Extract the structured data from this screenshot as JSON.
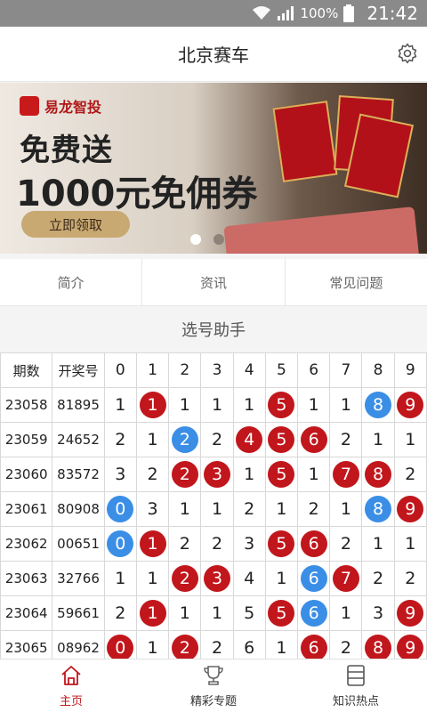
{
  "status": {
    "battery": "100%",
    "time": "21:42"
  },
  "header": {
    "title": "北京赛车"
  },
  "banner": {
    "brand": "易龙智投",
    "line1": "免费送",
    "line2": "1000元免佣券",
    "cta": "立即领取",
    "slides_active": 1,
    "slides_total": 2
  },
  "tabs": [
    {
      "label": "简介"
    },
    {
      "label": "资讯"
    },
    {
      "label": "常见问题"
    }
  ],
  "section_title": "选号助手",
  "table": {
    "headers": [
      "期数",
      "开奖号",
      "0",
      "1",
      "2",
      "3",
      "4",
      "5",
      "6",
      "7",
      "8",
      "9"
    ],
    "rows": [
      {
        "issue": "23058",
        "code": "81895",
        "cells": [
          {
            "v": "1",
            "s": ""
          },
          {
            "v": "1",
            "s": "red"
          },
          {
            "v": "1",
            "s": ""
          },
          {
            "v": "1",
            "s": ""
          },
          {
            "v": "1",
            "s": ""
          },
          {
            "v": "5",
            "s": "red"
          },
          {
            "v": "1",
            "s": ""
          },
          {
            "v": "1",
            "s": ""
          },
          {
            "v": "8",
            "s": "blue"
          },
          {
            "v": "9",
            "s": "red"
          }
        ]
      },
      {
        "issue": "23059",
        "code": "24652",
        "cells": [
          {
            "v": "2",
            "s": ""
          },
          {
            "v": "1",
            "s": ""
          },
          {
            "v": "2",
            "s": "blue"
          },
          {
            "v": "2",
            "s": ""
          },
          {
            "v": "4",
            "s": "red"
          },
          {
            "v": "5",
            "s": "red"
          },
          {
            "v": "6",
            "s": "red"
          },
          {
            "v": "2",
            "s": ""
          },
          {
            "v": "1",
            "s": ""
          },
          {
            "v": "1",
            "s": ""
          }
        ]
      },
      {
        "issue": "23060",
        "code": "83572",
        "cells": [
          {
            "v": "3",
            "s": ""
          },
          {
            "v": "2",
            "s": ""
          },
          {
            "v": "2",
            "s": "red"
          },
          {
            "v": "3",
            "s": "red"
          },
          {
            "v": "1",
            "s": ""
          },
          {
            "v": "5",
            "s": "red"
          },
          {
            "v": "1",
            "s": ""
          },
          {
            "v": "7",
            "s": "red"
          },
          {
            "v": "8",
            "s": "red"
          },
          {
            "v": "2",
            "s": ""
          }
        ]
      },
      {
        "issue": "23061",
        "code": "80908",
        "cells": [
          {
            "v": "0",
            "s": "blue"
          },
          {
            "v": "3",
            "s": ""
          },
          {
            "v": "1",
            "s": ""
          },
          {
            "v": "1",
            "s": ""
          },
          {
            "v": "2",
            "s": ""
          },
          {
            "v": "1",
            "s": ""
          },
          {
            "v": "2",
            "s": ""
          },
          {
            "v": "1",
            "s": ""
          },
          {
            "v": "8",
            "s": "blue"
          },
          {
            "v": "9",
            "s": "red"
          }
        ]
      },
      {
        "issue": "23062",
        "code": "00651",
        "cells": [
          {
            "v": "0",
            "s": "blue"
          },
          {
            "v": "1",
            "s": "red"
          },
          {
            "v": "2",
            "s": ""
          },
          {
            "v": "2",
            "s": ""
          },
          {
            "v": "3",
            "s": ""
          },
          {
            "v": "5",
            "s": "red"
          },
          {
            "v": "6",
            "s": "red"
          },
          {
            "v": "2",
            "s": ""
          },
          {
            "v": "1",
            "s": ""
          },
          {
            "v": "1",
            "s": ""
          }
        ]
      },
      {
        "issue": "23063",
        "code": "32766",
        "cells": [
          {
            "v": "1",
            "s": ""
          },
          {
            "v": "1",
            "s": ""
          },
          {
            "v": "2",
            "s": "red"
          },
          {
            "v": "3",
            "s": "red"
          },
          {
            "v": "4",
            "s": ""
          },
          {
            "v": "1",
            "s": ""
          },
          {
            "v": "6",
            "s": "blue"
          },
          {
            "v": "7",
            "s": "red"
          },
          {
            "v": "2",
            "s": ""
          },
          {
            "v": "2",
            "s": ""
          }
        ]
      },
      {
        "issue": "23064",
        "code": "59661",
        "cells": [
          {
            "v": "2",
            "s": ""
          },
          {
            "v": "1",
            "s": "red"
          },
          {
            "v": "1",
            "s": ""
          },
          {
            "v": "1",
            "s": ""
          },
          {
            "v": "5",
            "s": ""
          },
          {
            "v": "5",
            "s": "red"
          },
          {
            "v": "6",
            "s": "blue"
          },
          {
            "v": "1",
            "s": ""
          },
          {
            "v": "3",
            "s": ""
          },
          {
            "v": "9",
            "s": "red"
          }
        ]
      },
      {
        "issue": "23065",
        "code": "08962",
        "cells": [
          {
            "v": "0",
            "s": "red"
          },
          {
            "v": "1",
            "s": ""
          },
          {
            "v": "2",
            "s": "red"
          },
          {
            "v": "2",
            "s": ""
          },
          {
            "v": "6",
            "s": ""
          },
          {
            "v": "1",
            "s": ""
          },
          {
            "v": "6",
            "s": "red"
          },
          {
            "v": "2",
            "s": ""
          },
          {
            "v": "8",
            "s": "red"
          },
          {
            "v": "9",
            "s": "red"
          }
        ]
      }
    ]
  },
  "bottom_nav": [
    {
      "label": "主页",
      "icon": "home-icon",
      "active": true
    },
    {
      "label": "精彩专题",
      "icon": "trophy-icon",
      "active": false
    },
    {
      "label": "知识热点",
      "icon": "list-icon",
      "active": false
    }
  ],
  "colors": {
    "accent": "#c1161c",
    "ball_red": "#c1161c",
    "ball_blue": "#3a8ee6"
  }
}
